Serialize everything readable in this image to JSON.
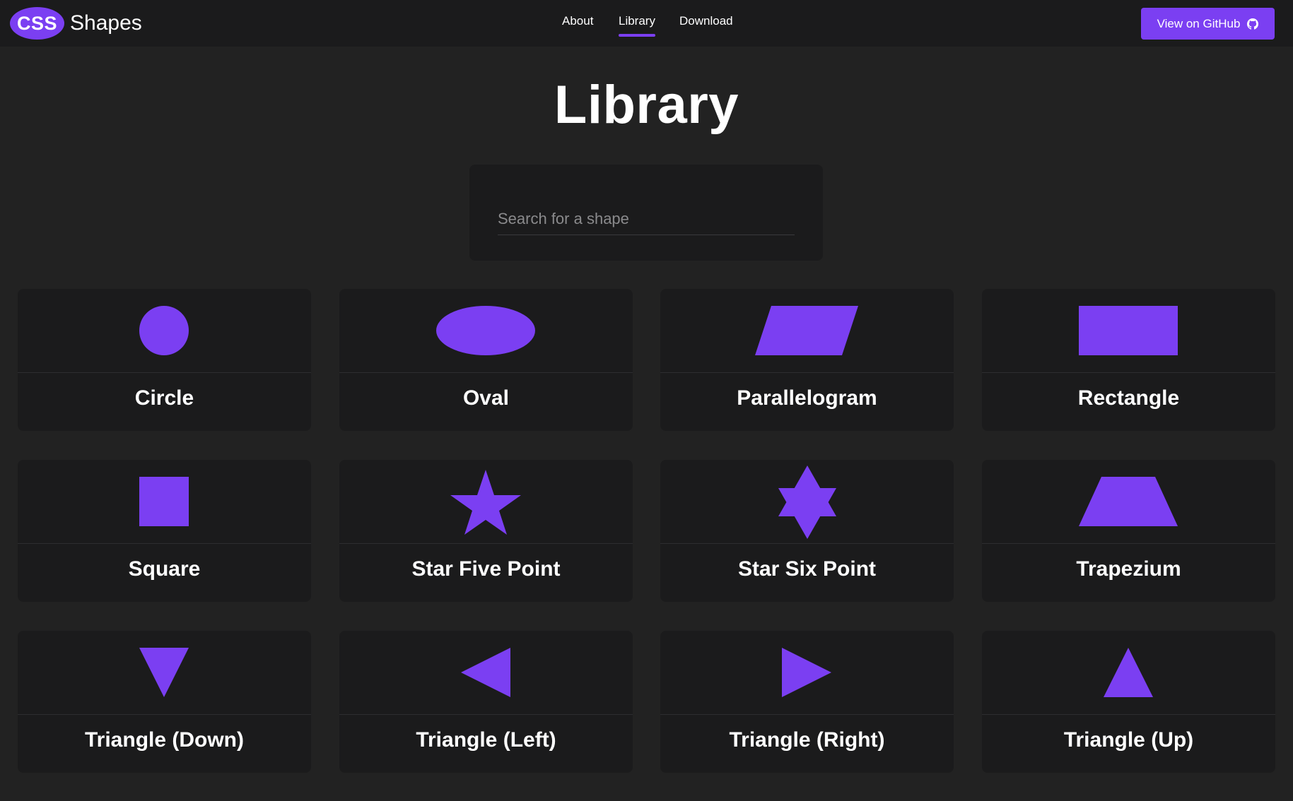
{
  "header": {
    "logo_badge": "CSS",
    "logo_word": "Shapes",
    "nav": [
      {
        "label": "About"
      },
      {
        "label": "Library",
        "active": true
      },
      {
        "label": "Download"
      }
    ],
    "github_button": "View on GitHub",
    "github_icon": "github-icon"
  },
  "page": {
    "title": "Library"
  },
  "search": {
    "placeholder": "Search for a shape",
    "value": ""
  },
  "shapes": [
    {
      "name": "Circle",
      "icon": "circle-icon"
    },
    {
      "name": "Oval",
      "icon": "oval-icon"
    },
    {
      "name": "Parallelogram",
      "icon": "parallelogram-icon"
    },
    {
      "name": "Rectangle",
      "icon": "rectangle-icon"
    },
    {
      "name": "Square",
      "icon": "square-icon"
    },
    {
      "name": "Star Five Point",
      "icon": "star-five-point-icon"
    },
    {
      "name": "Star Six Point",
      "icon": "star-six-point-icon"
    },
    {
      "name": "Trapezium",
      "icon": "trapezium-icon"
    },
    {
      "name": "Triangle (Down)",
      "icon": "triangle-down-icon"
    },
    {
      "name": "Triangle (Left)",
      "icon": "triangle-left-icon"
    },
    {
      "name": "Triangle (Right)",
      "icon": "triangle-right-icon"
    },
    {
      "name": "Triangle (Up)",
      "icon": "triangle-up-icon"
    }
  ],
  "colors": {
    "accent": "#7b3ff2",
    "background": "#222222",
    "surface": "#1b1b1c",
    "text": "#ffffff"
  }
}
